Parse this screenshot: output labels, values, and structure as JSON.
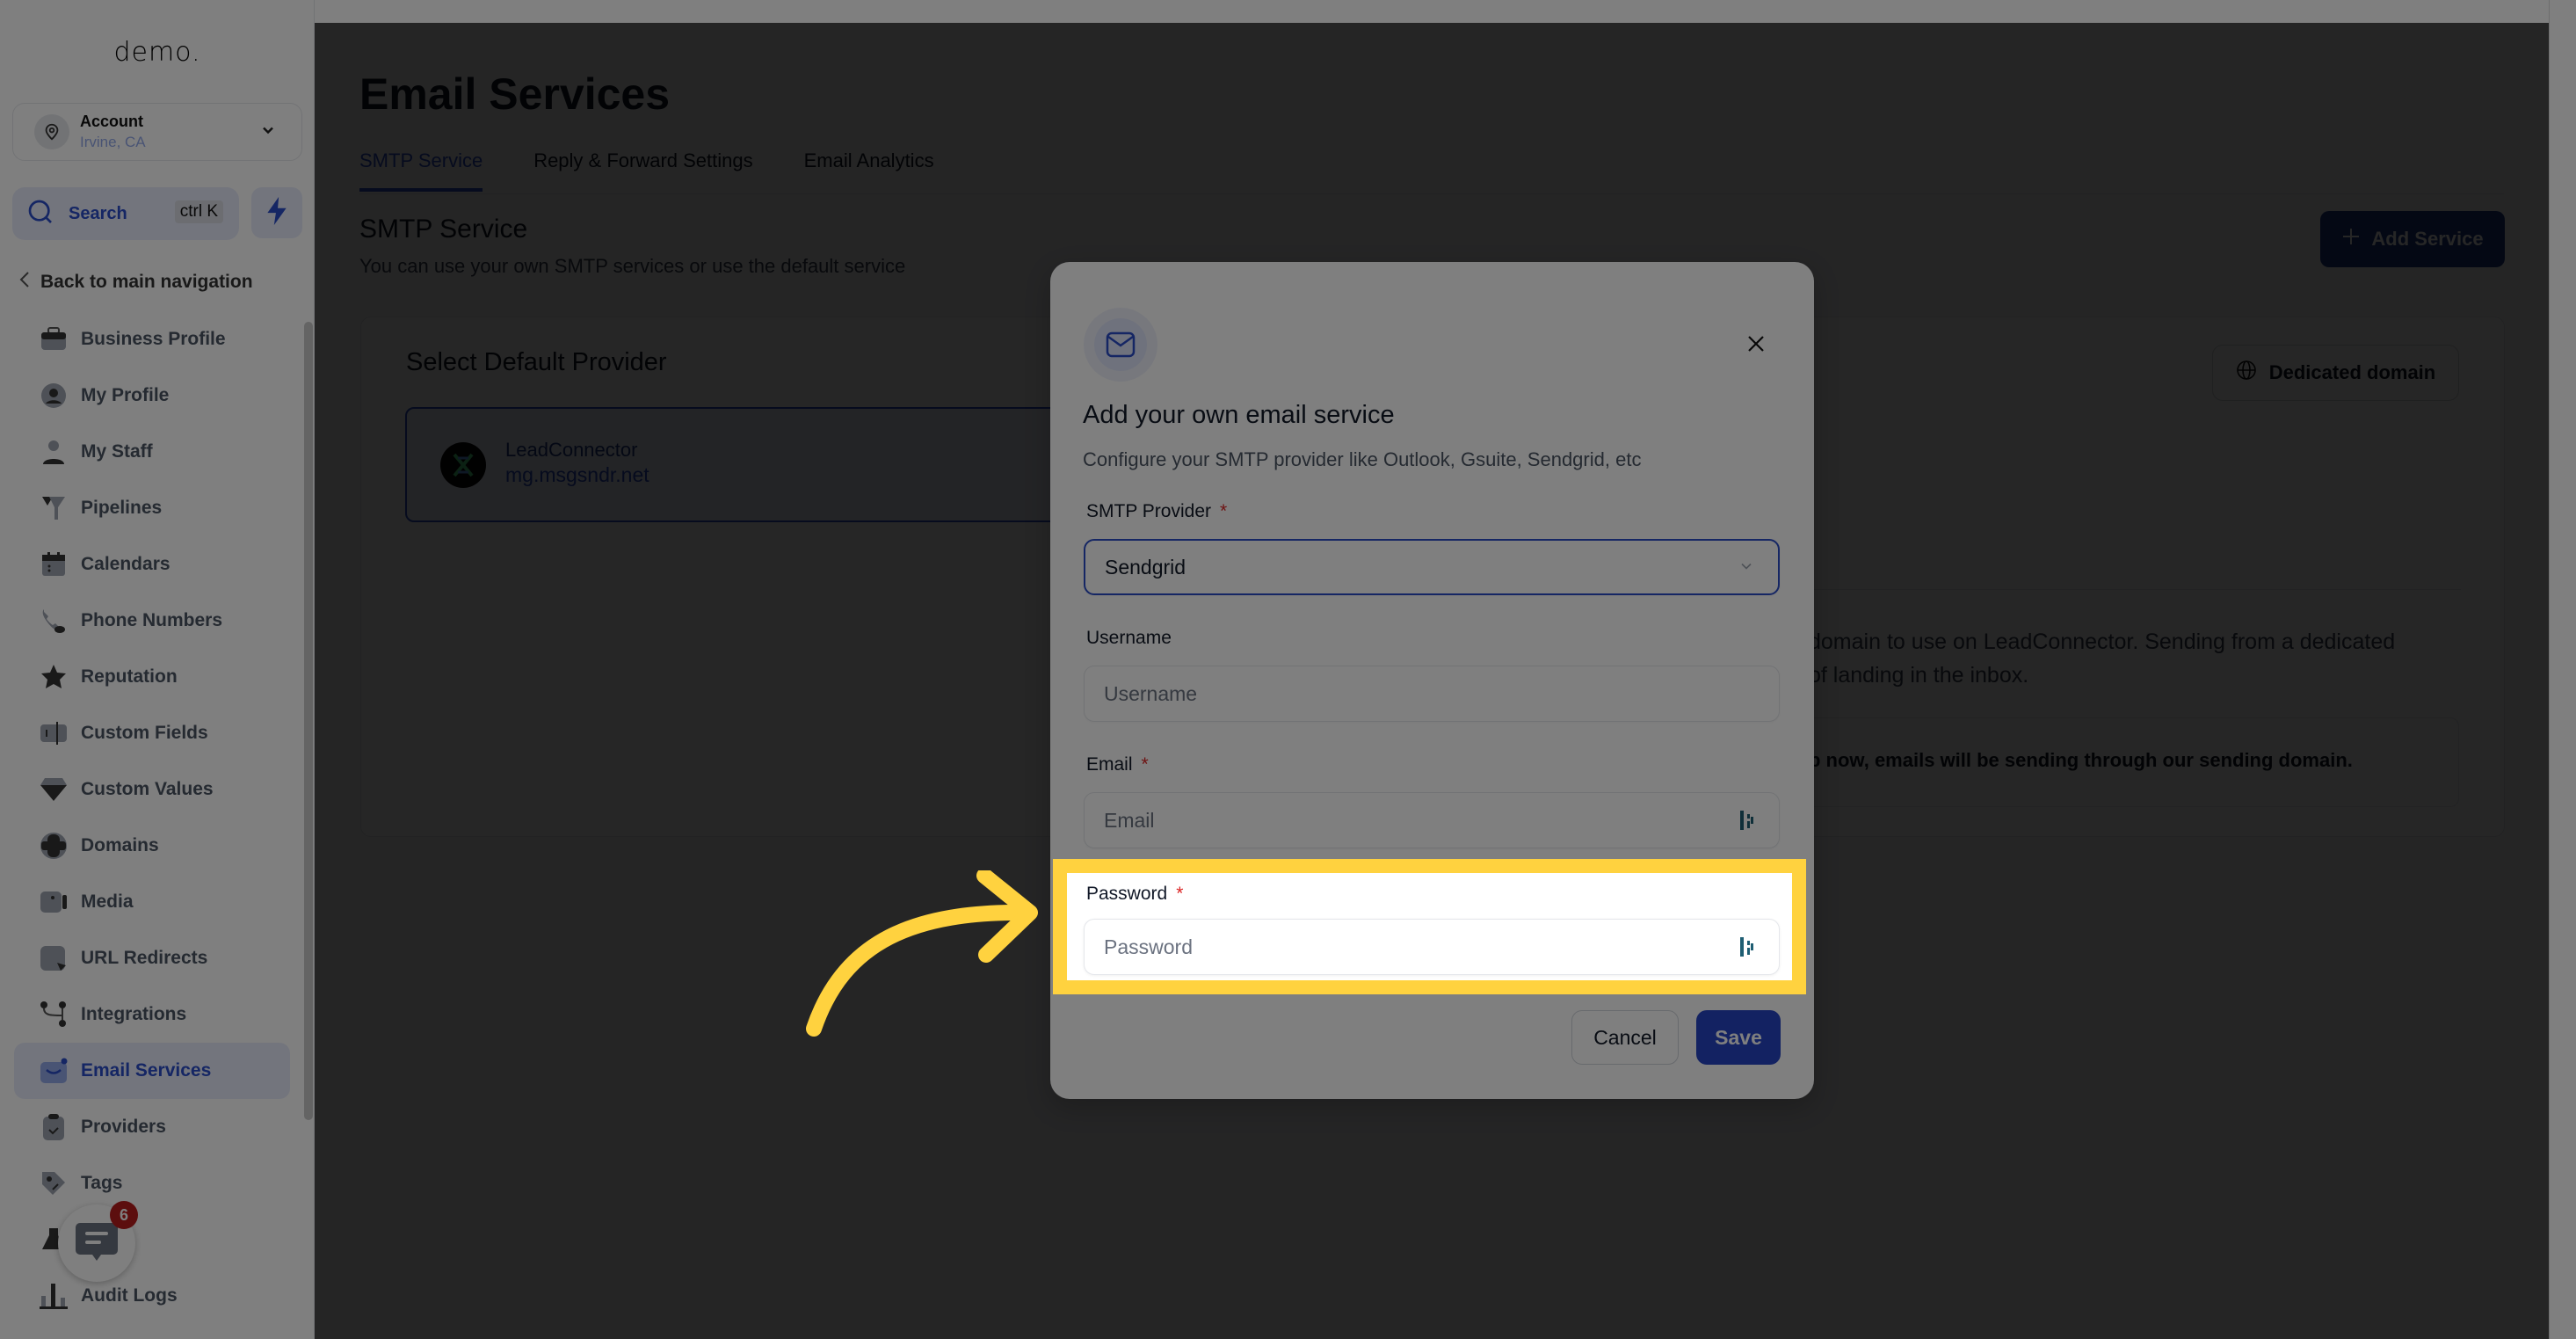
{
  "sidebar": {
    "logo": "demo.",
    "account": {
      "name": "Account",
      "location": "Irvine, CA"
    },
    "search": {
      "label": "Search",
      "shortcut": "ctrl K"
    },
    "back_label": "Back to main navigation",
    "items": [
      {
        "label": "Business Profile",
        "icon": "briefcase-icon"
      },
      {
        "label": "My Profile",
        "icon": "user-circle-icon"
      },
      {
        "label": "My Staff",
        "icon": "user-icon"
      },
      {
        "label": "Pipelines",
        "icon": "funnel-icon"
      },
      {
        "label": "Calendars",
        "icon": "calendar-icon"
      },
      {
        "label": "Phone Numbers",
        "icon": "phone-icon"
      },
      {
        "label": "Reputation",
        "icon": "star-icon"
      },
      {
        "label": "Custom Fields",
        "icon": "text-field-icon"
      },
      {
        "label": "Custom Values",
        "icon": "diamond-icon"
      },
      {
        "label": "Domains",
        "icon": "globe-icon"
      },
      {
        "label": "Media",
        "icon": "video-icon"
      },
      {
        "label": "URL Redirects",
        "icon": "redirect-icon"
      },
      {
        "label": "Integrations",
        "icon": "integrations-icon"
      },
      {
        "label": "Email Services",
        "icon": "email-icon",
        "active": true
      },
      {
        "label": "Providers",
        "icon": "clipboard-check-icon"
      },
      {
        "label": "Tags",
        "icon": "tag-icon"
      },
      {
        "label": "",
        "icon": "flask-icon",
        "badge": "new"
      },
      {
        "label": "Audit Logs",
        "icon": "bar-chart-icon"
      }
    ],
    "chat_badge_count": "6"
  },
  "main": {
    "title": "Email Services",
    "tabs": [
      {
        "label": "SMTP Service",
        "active": true
      },
      {
        "label": "Reply & Forward Settings"
      },
      {
        "label": "Email Analytics"
      }
    ],
    "section_title": "SMTP Service",
    "section_subtitle": "You can use your own SMTP services or use the default service",
    "add_service_label": "Add Service",
    "card_title": "Select Default Provider",
    "provider": {
      "name": "LeadConnector",
      "domain": "mg.msgsndr.net"
    },
    "dedicated_domain_label": "Dedicated domain",
    "dedicated_text_line1": "domain to use on LeadConnector. Sending from a dedicated",
    "dedicated_text_line2": "of landing in the inbox.",
    "dedicated_notice": "p now, emails will be sending through our sending domain."
  },
  "modal": {
    "title": "Add your own email service",
    "subtitle": "Configure your SMTP provider like Outlook, Gsuite, Sendgrid, etc",
    "fields": {
      "provider": {
        "label": "SMTP Provider",
        "required": "*",
        "value": "Sendgrid"
      },
      "username": {
        "label": "Username",
        "placeholder": "Username"
      },
      "email": {
        "label": "Email",
        "required": "*",
        "placeholder": "Email"
      },
      "password": {
        "label": "Password",
        "required": "*",
        "placeholder": "Password"
      }
    },
    "cancel_label": "Cancel",
    "save_label": "Save"
  },
  "annotation": {
    "highlight_color": "#ffd23f",
    "target": "password-field"
  },
  "colors": {
    "accent": "#2a4cc8",
    "primary_button": "#1e3a8a",
    "required": "#dc2626"
  }
}
